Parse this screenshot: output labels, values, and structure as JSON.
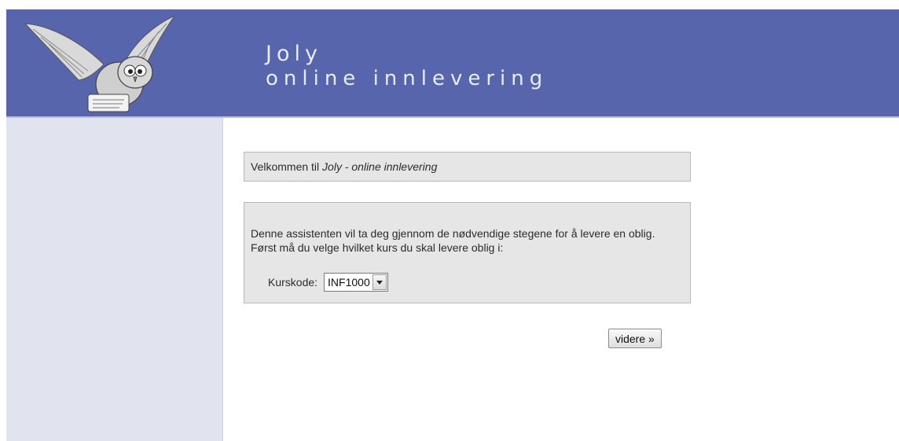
{
  "header": {
    "title": "Joly",
    "subtitle": "online innlevering",
    "bg_color": "#5765ad",
    "logo_icon": "owl-logo-icon"
  },
  "sidebar": {
    "bg_color": "#e1e3ef"
  },
  "welcome": {
    "prefix": "Velkommen til ",
    "app_name": "Joly - online innlevering"
  },
  "assistant": {
    "intro": "Denne assistenten vil ta deg gjennom de nødvendige stegene for å levere en oblig. Først må du velge hvilket kurs du skal levere oblig i:",
    "course_label": "Kurskode:",
    "course_selected": "INF1000",
    "dropdown_icon": "chevron-down-icon"
  },
  "next_button": {
    "label": "videre »"
  }
}
